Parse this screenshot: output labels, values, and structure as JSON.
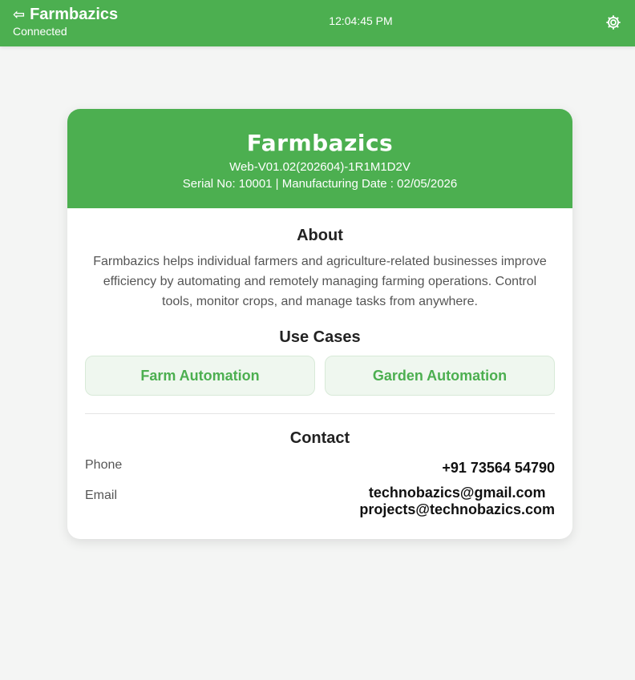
{
  "header": {
    "back_icon": "back-arrow-icon",
    "app_name": "Farmbazics",
    "connection_status": "Connected",
    "clock": "12:04:45 PM",
    "settings_icon": "gear-icon"
  },
  "card": {
    "title": "Farmbazics",
    "version": "Web-V01.02(202604)-1R1M1D2V",
    "serial_line": "Serial No: 10001 | Manufacturing Date : 02/05/2026",
    "about": {
      "title": "About",
      "text": "Farmbazics helps individual farmers and agriculture-related businesses improve efficiency by automating and remotely managing farming operations. Control tools, monitor crops, and manage tasks from anywhere."
    },
    "use_cases": {
      "title": "Use Cases",
      "items": [
        {
          "label": "Farm Automation"
        },
        {
          "label": "Garden Automation"
        }
      ]
    },
    "contact": {
      "title": "Contact",
      "phone_label": "Phone",
      "phone_value": "+91 73564 54790",
      "email_label": "Email",
      "emails": [
        "technobazics@gmail.com",
        "projects@technobazics.com"
      ]
    }
  },
  "colors": {
    "brand_green": "#4caf50",
    "usecase_bg": "#eff7ef",
    "page_bg": "#f4f5f4"
  }
}
